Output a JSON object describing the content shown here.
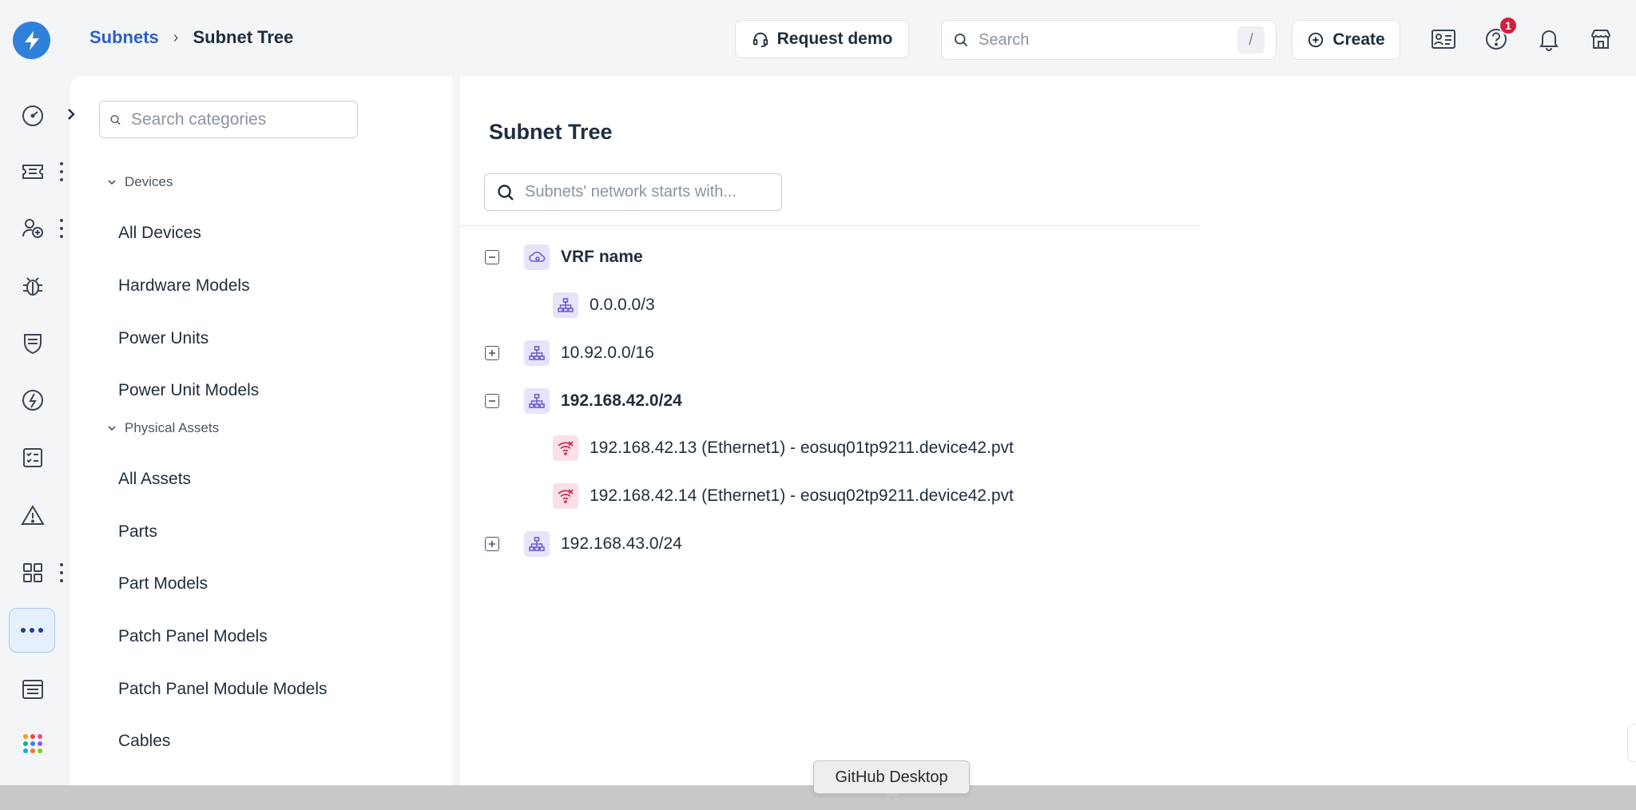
{
  "breadcrumb": {
    "parent": "Subnets",
    "separator": "›",
    "current": "Subnet Tree"
  },
  "header": {
    "request_demo": "Request demo",
    "search_placeholder": "Search",
    "search_shortcut": "/",
    "create": "Create",
    "help_badge": "1"
  },
  "categories": {
    "search_placeholder": "Search categories",
    "groups": [
      {
        "label": "Devices",
        "items": [
          "All Devices",
          "Hardware Models",
          "Power Units",
          "Power Unit Models"
        ]
      },
      {
        "label": "Physical Assets",
        "items": [
          "All Assets",
          "Parts",
          "Part Models",
          "Patch Panel Models",
          "Patch Panel Module Models",
          "Cables"
        ]
      }
    ]
  },
  "main": {
    "title": "Subnet Tree",
    "search_placeholder": "Subnets' network starts with...",
    "tree": [
      {
        "label": "VRF name",
        "state": "expanded",
        "level": 0,
        "kind": "vrf"
      },
      {
        "label": "0.0.0.0/3",
        "state": "leaf",
        "level": 1,
        "kind": "subnet"
      },
      {
        "label": "10.92.0.0/16",
        "state": "collapsed",
        "level": 0,
        "kind": "subnet"
      },
      {
        "label": "192.168.42.0/24",
        "state": "expanded",
        "level": 0,
        "kind": "subnet"
      },
      {
        "label": "192.168.42.13 (Ethernet1) - eosuq01tp9211.device42.pvt",
        "state": "leaf",
        "level": 1,
        "kind": "ip"
      },
      {
        "label": "192.168.42.14 (Ethernet1) - eosuq02tp9211.device42.pvt",
        "state": "leaf",
        "level": 1,
        "kind": "ip"
      },
      {
        "label": "192.168.43.0/24",
        "state": "collapsed",
        "level": 0,
        "kind": "subnet"
      }
    ]
  },
  "tooltip": "GitHub Desktop",
  "colors": {
    "brand": "#2f80d8",
    "link": "#2c5fcc",
    "badge": "#d21f3c",
    "subnet_icon_bg": "#e6e4f8",
    "ip_icon_bg": "#fbe0e6"
  }
}
